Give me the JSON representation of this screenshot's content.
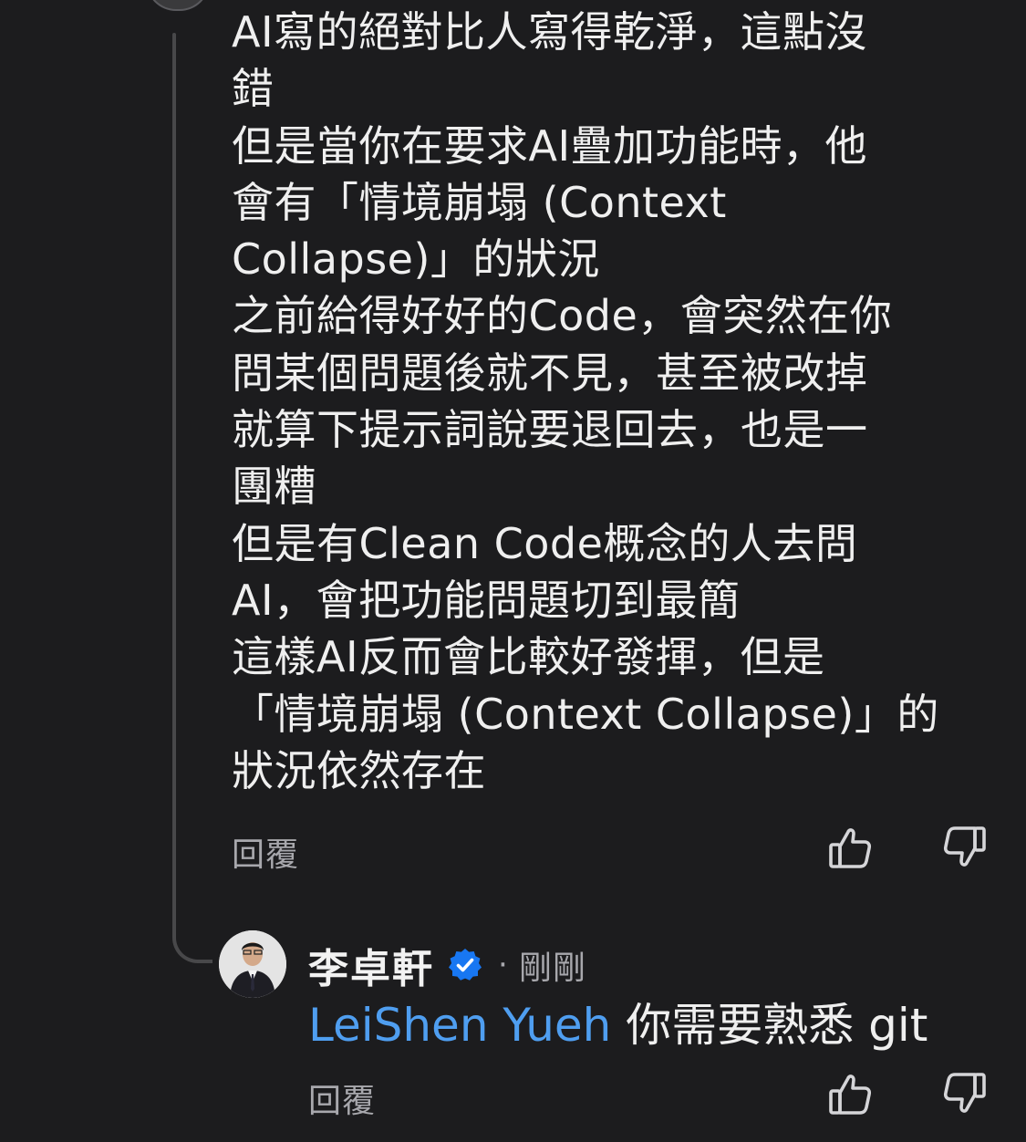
{
  "comment": {
    "lines": [
      "AI寫的絕對比人寫得乾淨，這點沒",
      "錯",
      "但是當你在要求AI疊加功能時，他",
      "會有「情境崩塌 (Context",
      "Collapse)」的狀況",
      "之前給得好好的Code，會突然在你",
      "問某個問題後就不見，甚至被改掉",
      "就算下提示詞說要退回去，也是一",
      "團糟",
      "但是有Clean Code概念的人去問",
      " AI，會把功能問題切到最簡",
      "這樣AI反而會比較好發揮，但是",
      "「情境崩塌 (Context Collapse)」的",
      "狀況依然存在"
    ],
    "reply_label": "回覆",
    "like_icon": "thumbs-up-icon",
    "dislike_icon": "thumbs-down-icon"
  },
  "reply": {
    "author": "李卓軒",
    "verified_icon": "verified-badge-icon",
    "separator": "·",
    "time": "剛剛",
    "mention": "LeiShen Yueh",
    "text": " 你需要熟悉 git",
    "reply_label": "回覆",
    "like_icon": "thumbs-up-icon",
    "dislike_icon": "thumbs-down-icon"
  },
  "colors": {
    "background": "#1c1c1e",
    "text": "#efefef",
    "muted": "#a8a8ad",
    "mention": "#4f9ef0",
    "verified": "#1877f2"
  }
}
